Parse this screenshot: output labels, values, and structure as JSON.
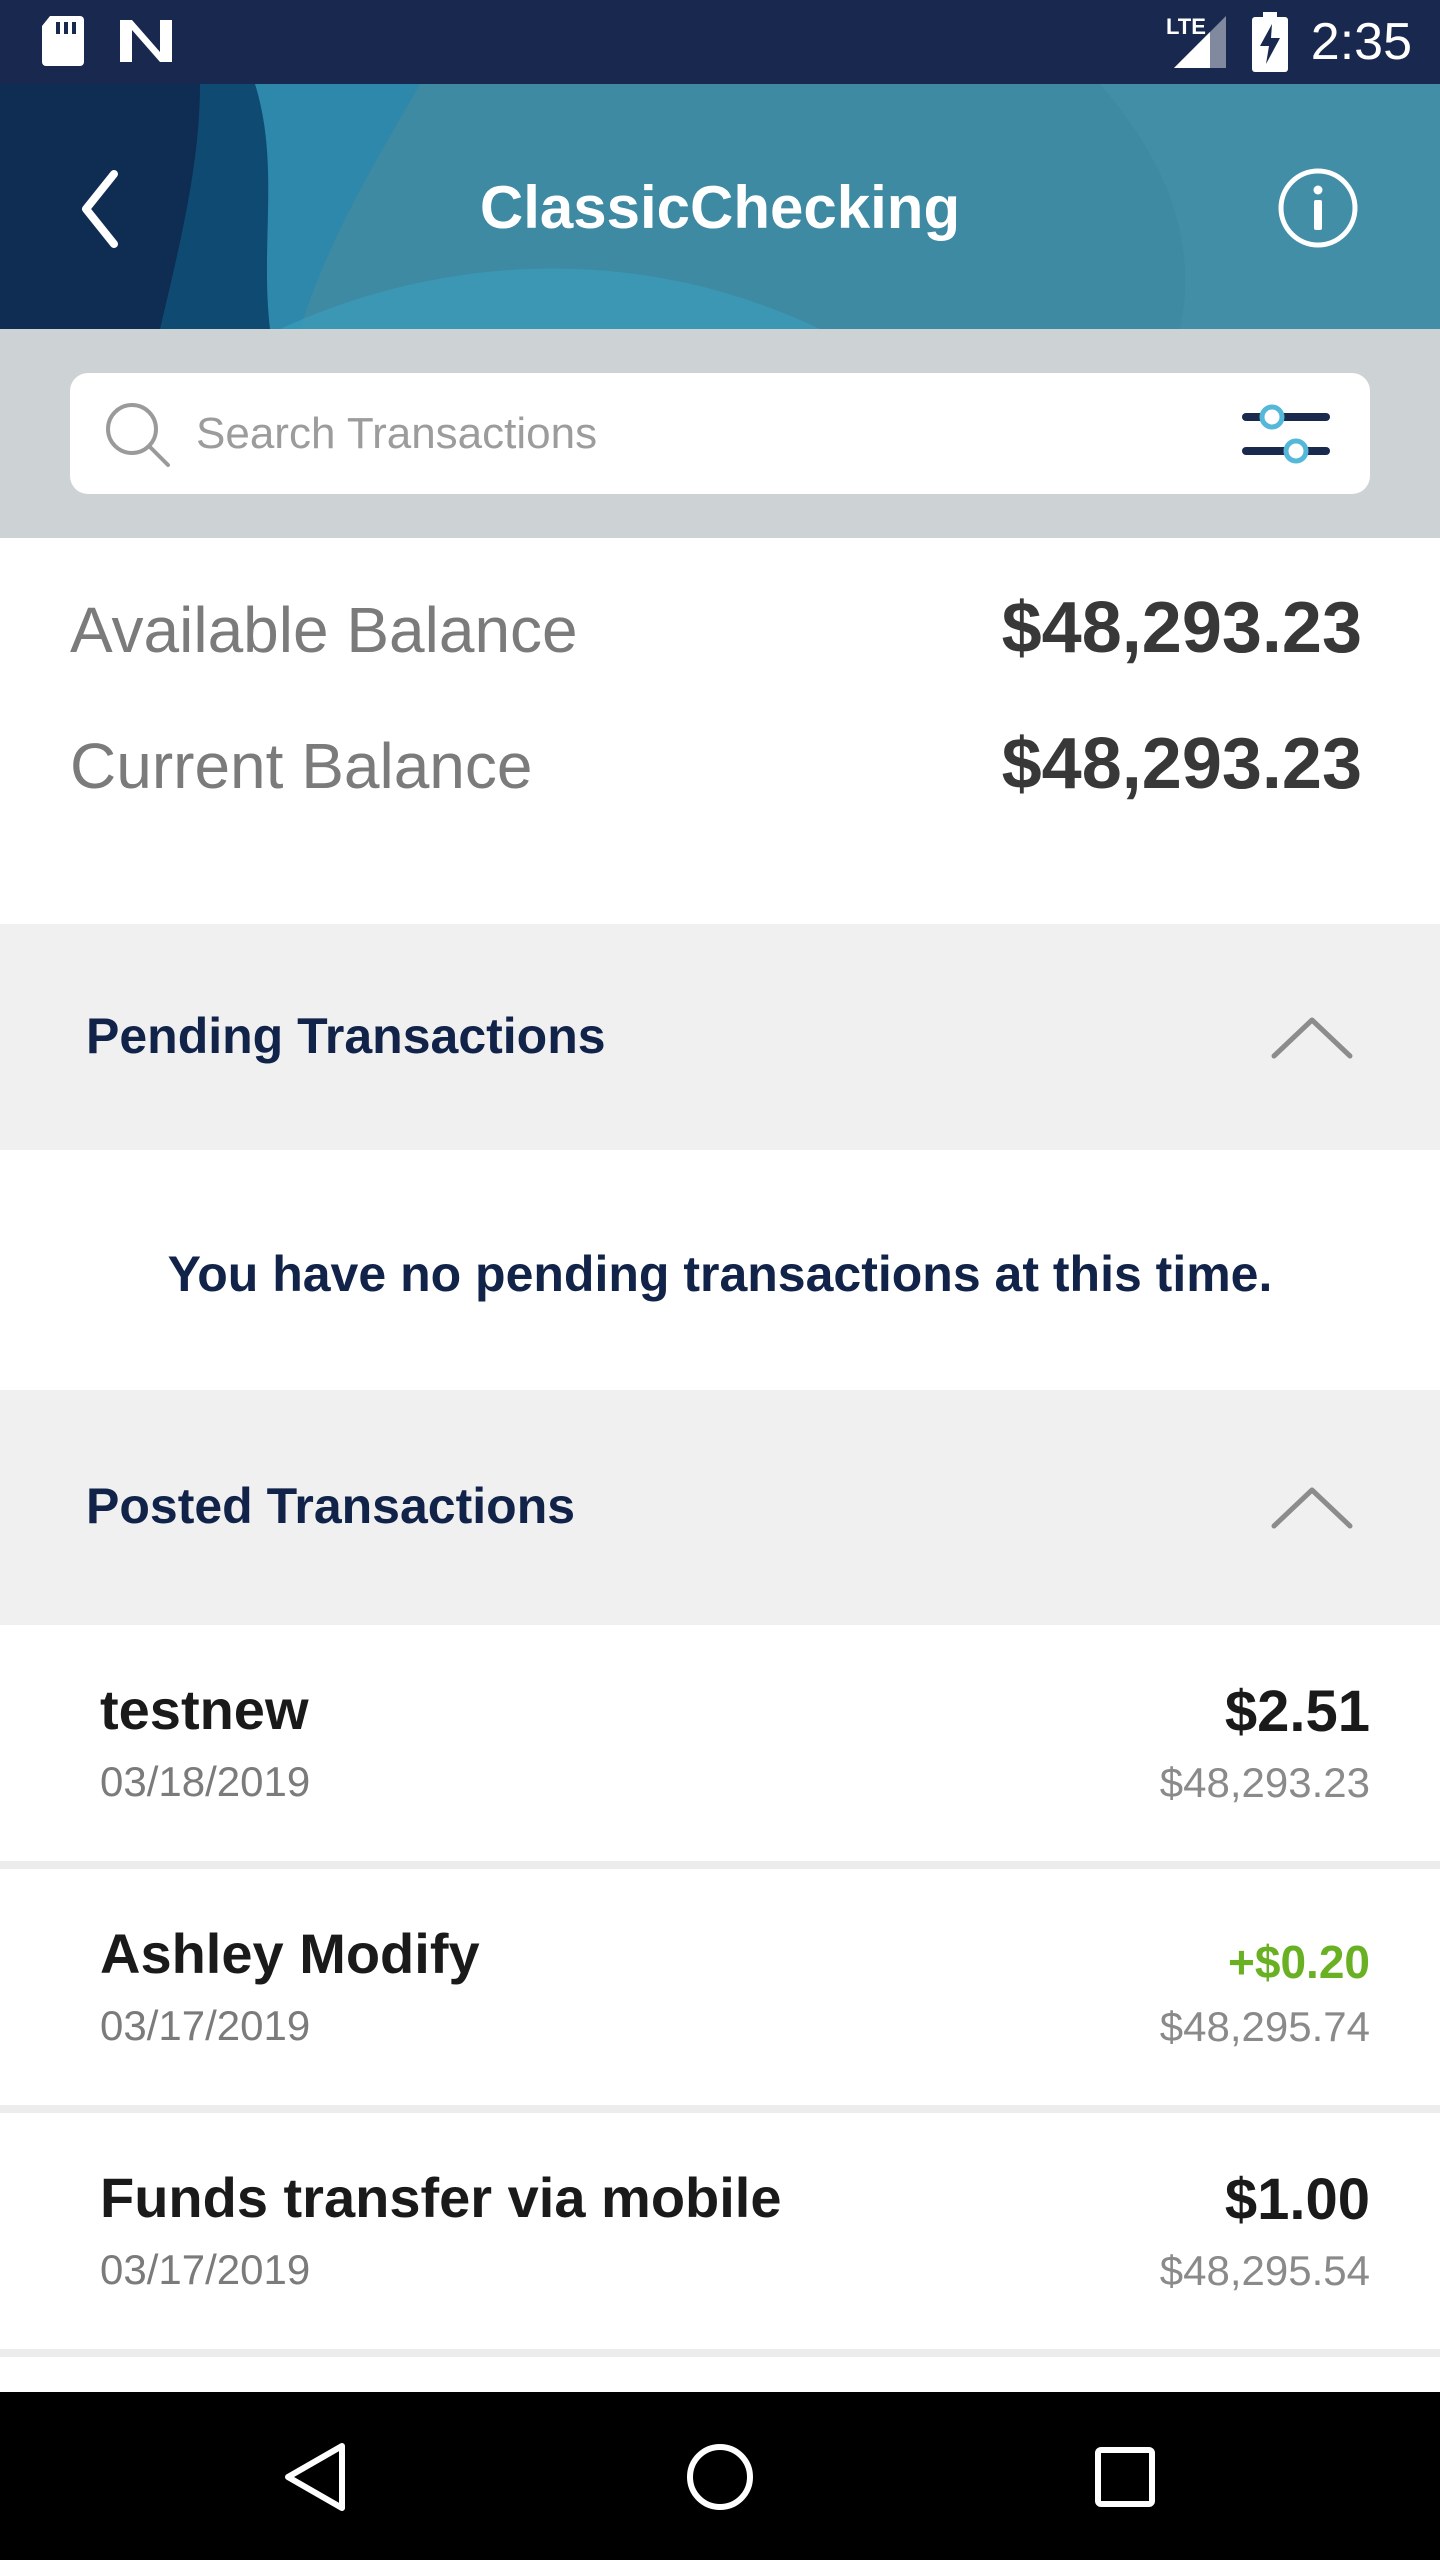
{
  "status_bar": {
    "time": "2:35",
    "network": "LTE",
    "icons": [
      "sd-card-icon",
      "n-logo-icon",
      "signal-icon",
      "battery-charging-icon"
    ]
  },
  "header": {
    "title": "ClassicChecking",
    "back_icon": "chevron-left-icon",
    "info_icon": "info-icon"
  },
  "search": {
    "placeholder": "Search Transactions",
    "value": "",
    "filter_icon": "sliders-icon"
  },
  "balances": {
    "available_label": "Available Balance",
    "available_value": "$48,293.23",
    "current_label": "Current Balance",
    "current_value": "$48,293.23"
  },
  "pending": {
    "title": "Pending Transactions",
    "empty_message": "You have no pending transactions at this time."
  },
  "posted": {
    "title": "Posted Transactions",
    "transactions": [
      {
        "name": "testnew",
        "date": "03/18/2019",
        "amount": "$2.51",
        "balance": "$48,293.23",
        "type": "debit"
      },
      {
        "name": "Ashley Modify",
        "date": "03/17/2019",
        "amount": "+$0.20",
        "balance": "$48,295.74",
        "type": "credit"
      },
      {
        "name": "Funds transfer via mobile",
        "date": "03/17/2019",
        "amount": "$1.00",
        "balance": "$48,295.54",
        "type": "debit"
      }
    ]
  },
  "colors": {
    "status_bar": "#19284f",
    "header_teal": "#3b8aa3",
    "navy_text": "#12234a",
    "credit_green": "#6ab023",
    "section_bg": "#f0f0f0"
  },
  "nav_bar": {
    "buttons": [
      "back-triangle-icon",
      "home-circle-icon",
      "recents-square-icon"
    ]
  }
}
